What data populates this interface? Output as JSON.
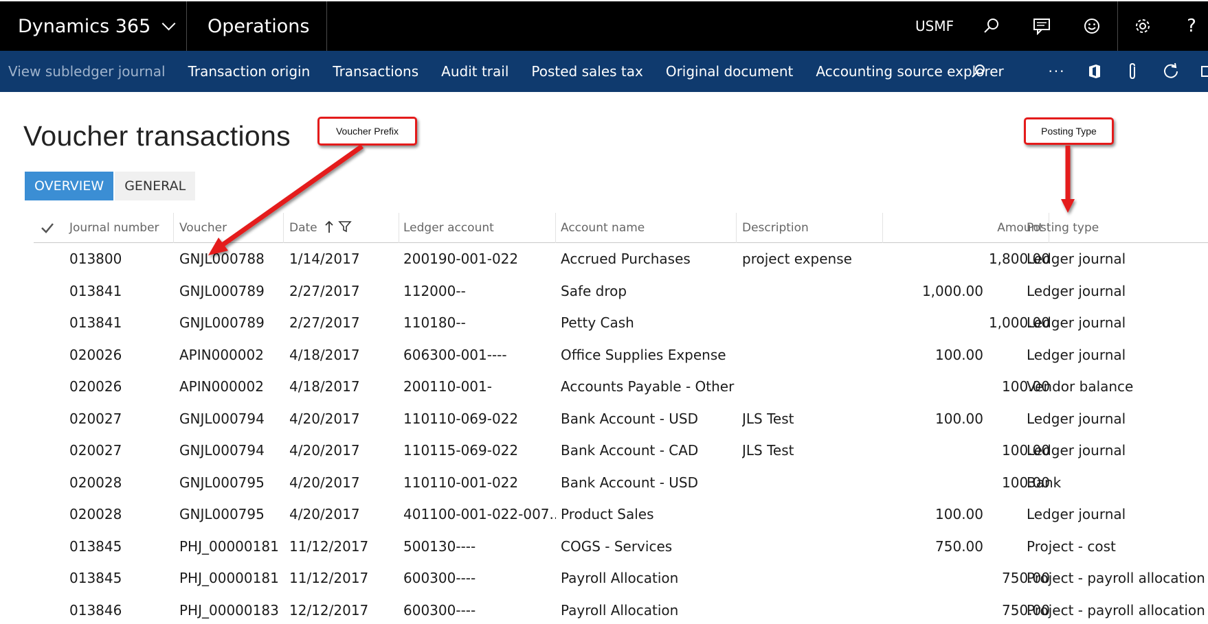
{
  "topbar": {
    "brand": "Dynamics 365",
    "module": "Operations",
    "company": "USMF"
  },
  "actions": [
    "View subledger journal",
    "Transaction origin",
    "Transactions",
    "Audit trail",
    "Posted sales tax",
    "Original document",
    "Accounting source explorer"
  ],
  "page": {
    "title": "Voucher transactions"
  },
  "tabs": [
    "OVERVIEW",
    "GENERAL"
  ],
  "grid": {
    "columns": [
      "Journal number",
      "Voucher",
      "Date",
      "Ledger account",
      "Account name",
      "Description",
      "Amount",
      "Posting type"
    ],
    "rows": [
      {
        "journal": "013800",
        "voucher": "GNJL000788",
        "date": "1/14/2017",
        "ledger": "200190-001-022",
        "name": "Accrued Purchases",
        "desc": "project expense",
        "debit": "",
        "credit": "1,800.00",
        "type": "Ledger journal"
      },
      {
        "journal": "013841",
        "voucher": "GNJL000789",
        "date": "2/27/2017",
        "ledger": "112000--",
        "name": "Safe drop",
        "desc": "",
        "debit": "1,000.00",
        "credit": "",
        "type": "Ledger journal"
      },
      {
        "journal": "013841",
        "voucher": "GNJL000789",
        "date": "2/27/2017",
        "ledger": "110180--",
        "name": "Petty Cash",
        "desc": "",
        "debit": "",
        "credit": "1,000.00",
        "type": "Ledger journal"
      },
      {
        "journal": "020026",
        "voucher": "APIN000002",
        "date": "4/18/2017",
        "ledger": "606300-001----",
        "name": "Office Supplies Expense",
        "desc": "",
        "debit": "100.00",
        "credit": "",
        "type": "Ledger journal"
      },
      {
        "journal": "020026",
        "voucher": "APIN000002",
        "date": "4/18/2017",
        "ledger": "200110-001-",
        "name": "Accounts Payable - Other",
        "desc": "",
        "debit": "",
        "credit": "100.00",
        "type": "Vendor balance"
      },
      {
        "journal": "020027",
        "voucher": "GNJL000794",
        "date": "4/20/2017",
        "ledger": "110110-069-022",
        "name": "Bank Account - USD",
        "desc": "JLS Test",
        "debit": "100.00",
        "credit": "",
        "type": "Ledger journal"
      },
      {
        "journal": "020027",
        "voucher": "GNJL000794",
        "date": "4/20/2017",
        "ledger": "110115-069-022",
        "name": "Bank Account - CAD",
        "desc": "JLS Test",
        "debit": "",
        "credit": "100.00",
        "type": "Ledger journal"
      },
      {
        "journal": "020028",
        "voucher": "GNJL000795",
        "date": "4/20/2017",
        "ledger": "110110-001-022",
        "name": "Bank Account - USD",
        "desc": "",
        "debit": "",
        "credit": "100.00",
        "type": "Bank"
      },
      {
        "journal": "020028",
        "voucher": "GNJL000795",
        "date": "4/20/2017",
        "ledger": "401100-001-022-007...",
        "name": "Product Sales",
        "desc": "",
        "debit": "100.00",
        "credit": "",
        "type": "Ledger journal"
      },
      {
        "journal": "013845",
        "voucher": "PHJ_00000181",
        "date": "11/12/2017",
        "ledger": "500130----",
        "name": "COGS - Services",
        "desc": "",
        "debit": "750.00",
        "credit": "",
        "type": "Project - cost"
      },
      {
        "journal": "013845",
        "voucher": "PHJ_00000181",
        "date": "11/12/2017",
        "ledger": "600300----",
        "name": "Payroll Allocation",
        "desc": "",
        "debit": "",
        "credit": "750.00",
        "type": "Project - payroll allocation"
      },
      {
        "journal": "013846",
        "voucher": "PHJ_00000183",
        "date": "12/12/2017",
        "ledger": "600300----",
        "name": "Payroll Allocation",
        "desc": "",
        "debit": "",
        "credit": "750.00",
        "type": "Project - payroll allocation"
      }
    ]
  },
  "callouts": {
    "voucher_prefix": "Voucher Prefix",
    "posting_type": "Posting Type"
  },
  "icons": {
    "top": [
      "search-icon",
      "message-icon",
      "smiley-icon",
      "gear-icon",
      "help-icon"
    ],
    "action": [
      "search-icon",
      "more-icon",
      "office-icon",
      "attach-icon",
      "refresh-icon"
    ]
  },
  "colors": {
    "actionbar": "#0f3a6e",
    "active_tab": "#3b8ed4",
    "callout_red": "#e41b1b"
  }
}
